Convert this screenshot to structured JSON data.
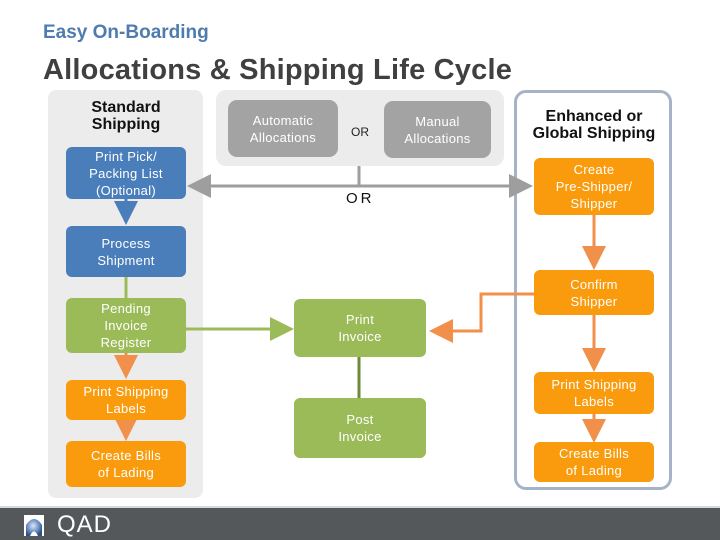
{
  "header": {
    "subtitle": "Easy On-Boarding",
    "title": "Allocations & Shipping Life Cycle"
  },
  "standard": {
    "title_line1": "Standard",
    "title_line2": "Shipping",
    "steps": [
      {
        "l1": "Print Pick/",
        "l2": "Packing List",
        "l3": "(Optional)"
      },
      {
        "l1": "Process",
        "l2": "Shipment"
      },
      {
        "l1": "Pending",
        "l2": "Invoice",
        "l3": "Register"
      },
      {
        "l1": "Print Shipping",
        "l2": "Labels"
      },
      {
        "l1": "Create Bills",
        "l2": "of Lading"
      }
    ]
  },
  "allocations": {
    "automatic_l1": "Automatic",
    "automatic_l2": "Allocations",
    "or_small": "OR",
    "manual_l1": "Manual",
    "manual_l2": "Allocations",
    "or_big": "OR"
  },
  "invoice": {
    "print_l1": "Print",
    "print_l2": "Invoice",
    "post_l1": "Post",
    "post_l2": "Invoice"
  },
  "enhanced": {
    "title_line1": "Enhanced or",
    "title_line2": "Global Shipping",
    "steps": [
      {
        "l1": "Create",
        "l2": "Pre-Shipper/",
        "l3": "Shipper"
      },
      {
        "l1": "Confirm",
        "l2": "Shipper"
      },
      {
        "l1": "Print Shipping",
        "l2": "Labels"
      },
      {
        "l1": "Create Bills",
        "l2": "of Lading"
      }
    ]
  },
  "footer": {
    "logo_text": "QAD"
  },
  "colors": {
    "blue": "#4a7ebb",
    "green": "#9bbb59",
    "orange": "#f99b0c",
    "gray": "#a3a3a3",
    "orange_connector": "#f0904a",
    "footer_bg": "#55585a",
    "subtitle": "#4e7cae"
  }
}
